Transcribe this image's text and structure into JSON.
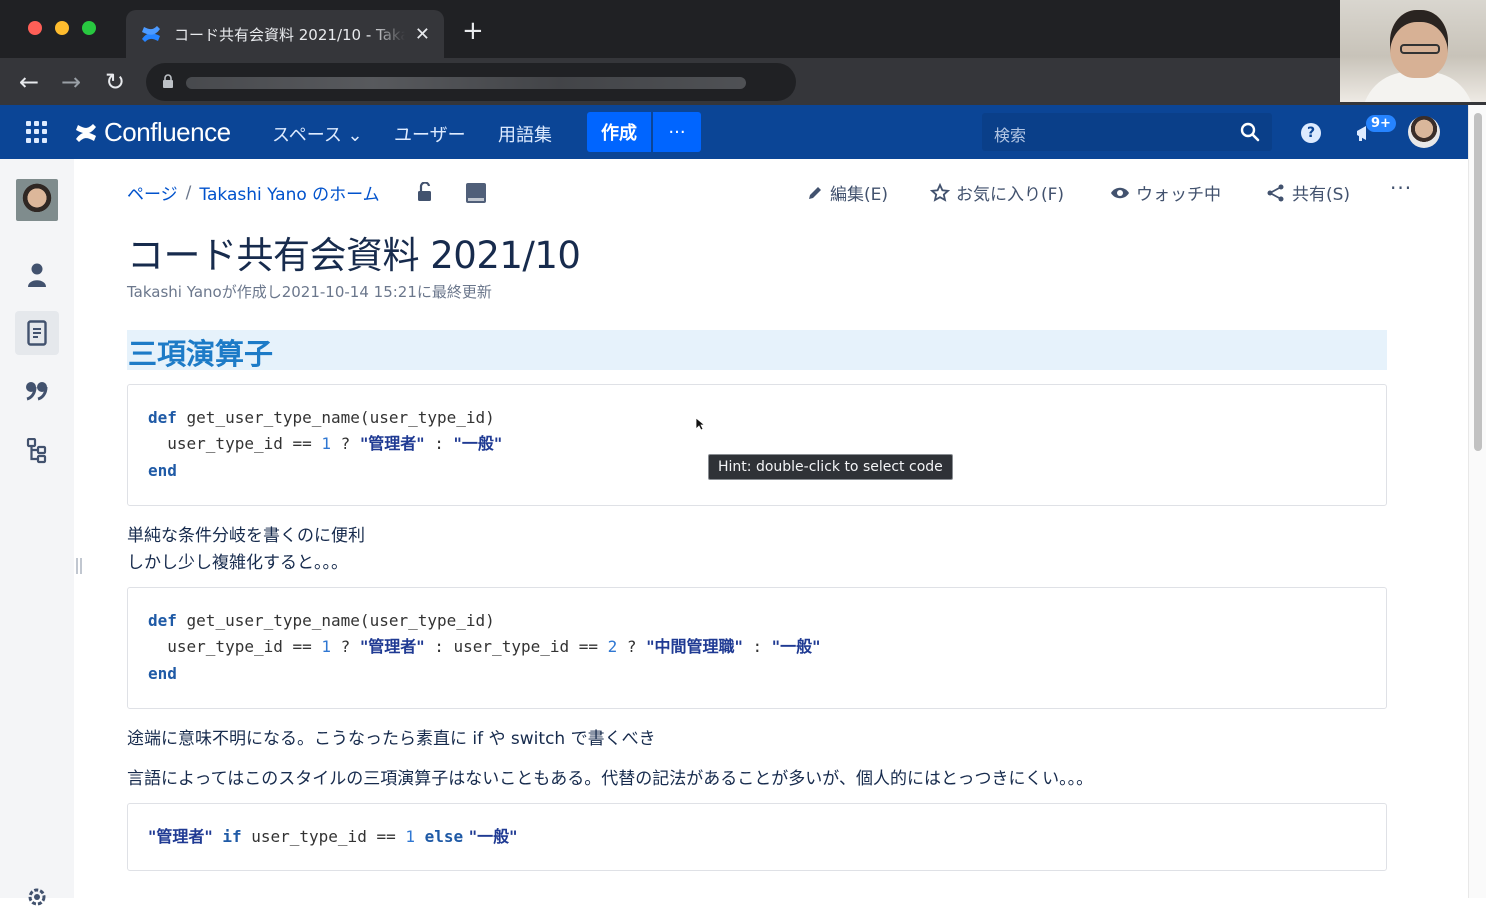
{
  "browser": {
    "tab_title": "コード共有会資料 2021/10 - Taka",
    "close_glyph": "✕",
    "new_tab_glyph": "+",
    "back_glyph": "←",
    "forward_glyph": "→",
    "reload_glyph": "↻"
  },
  "header": {
    "logo_text": "Confluence",
    "nav": {
      "spaces": "スペース ⌄",
      "users": "ユーザー",
      "glossary": "用語集"
    },
    "create_label": "作成",
    "more_label": "···",
    "search_placeholder": "検索",
    "help_glyph": "?",
    "notification_badge": "9+"
  },
  "breadcrumb": {
    "root": "ページ",
    "separator": "/",
    "parent": "Takashi Yano のホーム"
  },
  "actions": {
    "edit": "編集(E)",
    "favorite": "お気に入り(F)",
    "watch": "ウォッチ中",
    "share": "共有(S)",
    "more": "···"
  },
  "page": {
    "title": "コード共有会資料 2021/10",
    "byline": "Takashi Yanoが作成し2021-10-14 15:21に最終更新",
    "heading": "三項演算子",
    "para1": "単純な条件分岐を書くのに便利",
    "para2": "しかし少し複雑化すると。。。",
    "para3": "途端に意味不明になる。こうなったら素直に if や switch で書くべき",
    "para4": "言語によってはこのスタイルの三項演算子はないこともある。代替の記法があることが多いが、個人的にはとっつきにくい。。。"
  },
  "code1": {
    "l1_kw": "def",
    "l1_rest": " get_user_type_name(user_type_id)",
    "l2_a": "  user_type_id == ",
    "l2_num": "1",
    "l2_b": " ? ",
    "l2_s1": "\"管理者\"",
    "l2_c": " : ",
    "l2_s2": "\"一般\"",
    "l3_kw": "end"
  },
  "code2": {
    "l1_kw": "def",
    "l1_rest": " get_user_type_name(user_type_id)",
    "l2_a": "  user_type_id == ",
    "l2_num1": "1",
    "l2_b": " ? ",
    "l2_s1": "\"管理者\"",
    "l2_c": " : user_type_id == ",
    "l2_num2": "2",
    "l2_d": " ? ",
    "l2_s2": "\"中間管理職\"",
    "l2_e": " : ",
    "l2_s3": "\"一般\"",
    "l3_kw": "end"
  },
  "code3": {
    "s1": "\"管理者\"",
    "kw_if": " if",
    "mid": " user_type_id == ",
    "num": "1",
    "kw_else": " else",
    "s2": " \"一般\""
  },
  "tooltip": {
    "hint": "Hint: double-click to select code"
  },
  "colors": {
    "header_bg": "#0b4596",
    "create_bg": "#0065ff",
    "heading_color": "#1d7bc7",
    "heading_band": "#e6f2fb"
  }
}
